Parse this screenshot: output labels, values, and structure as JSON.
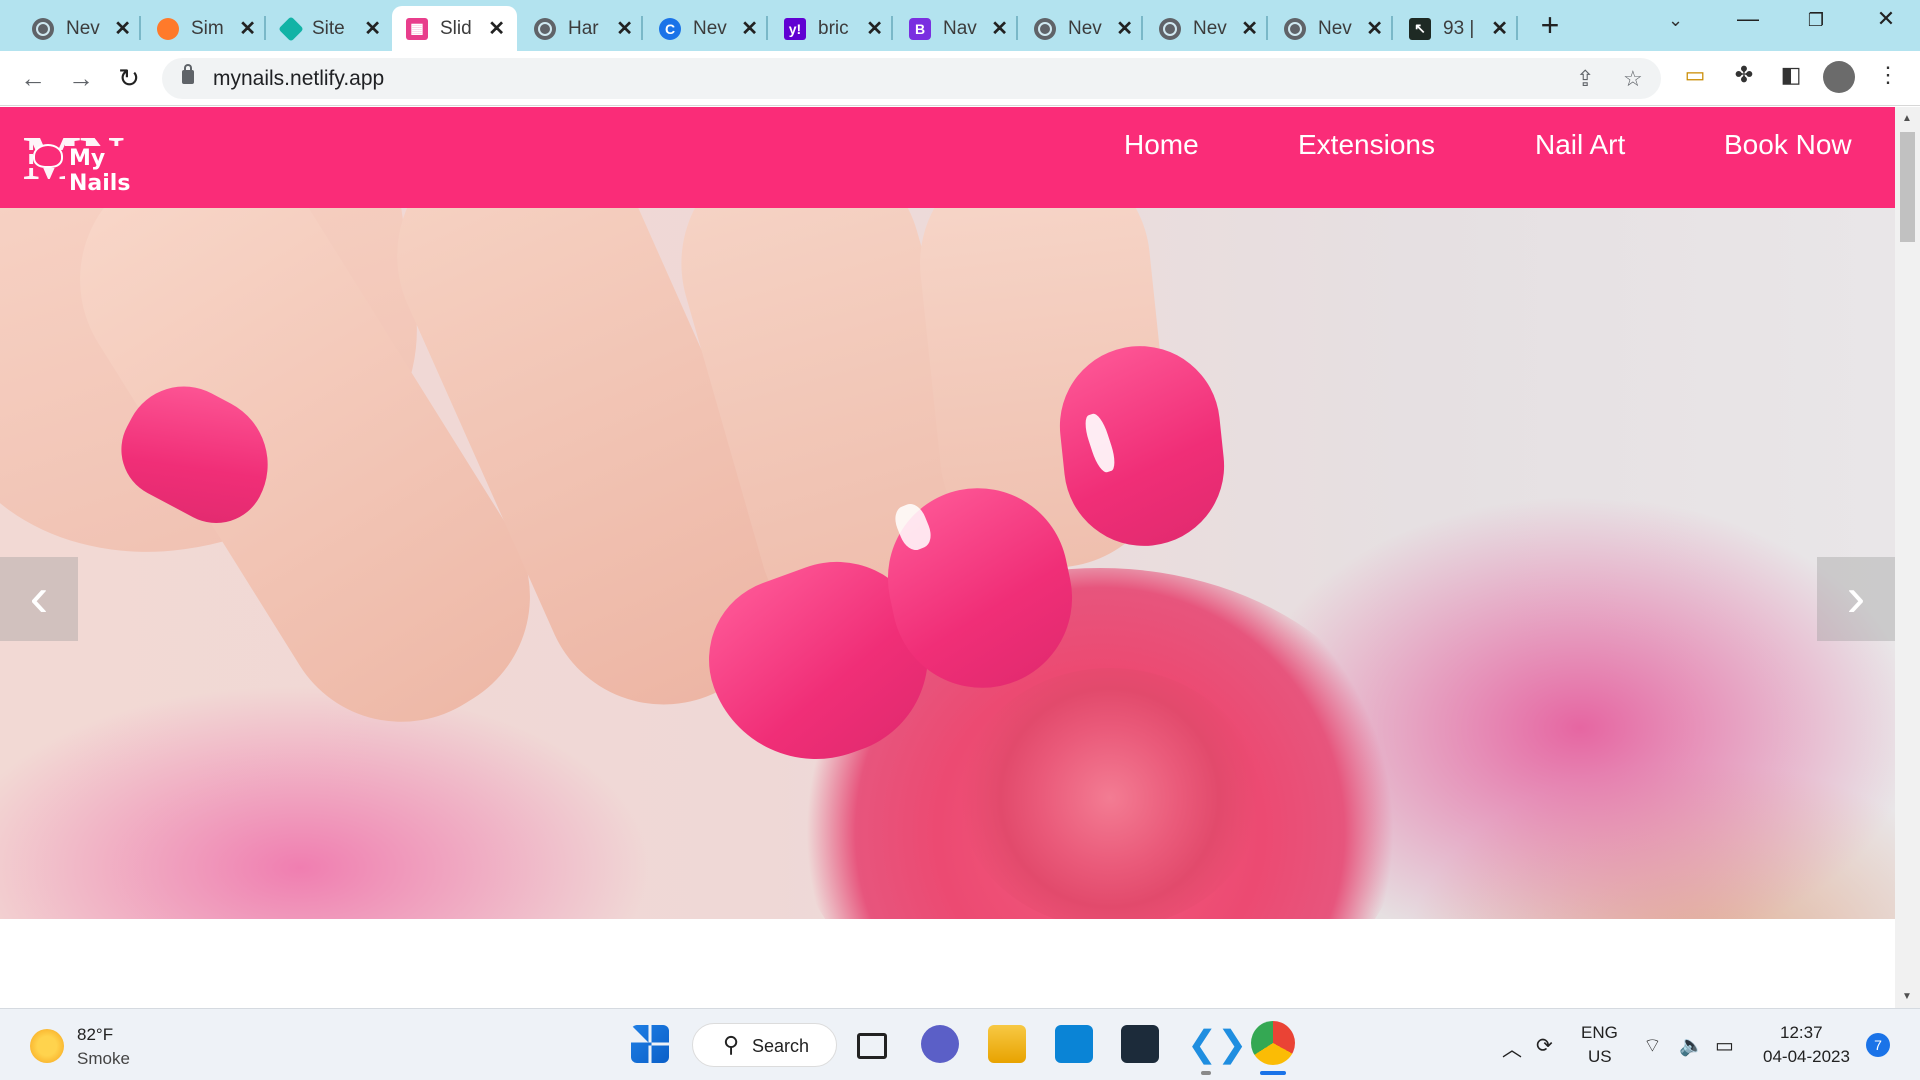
{
  "browser": {
    "tabs": [
      {
        "title": "Nev",
        "favicon": "globe-icon"
      },
      {
        "title": "Sim",
        "favicon": "orange-avatar-icon"
      },
      {
        "title": "Site",
        "favicon": "teal-diamond-icon"
      },
      {
        "title": "Slid",
        "favicon": "pink-grid-icon",
        "active": true
      },
      {
        "title": "Har",
        "favicon": "globe-icon"
      },
      {
        "title": "Nev",
        "favicon": "blue-c-icon"
      },
      {
        "title": "bric",
        "favicon": "yahoo-icon"
      },
      {
        "title": "Nav",
        "favicon": "bootstrap-icon"
      },
      {
        "title": "Nev",
        "favicon": "globe-icon"
      },
      {
        "title": "Nev",
        "favicon": "globe-icon"
      },
      {
        "title": "Nev",
        "favicon": "globe-icon"
      },
      {
        "title": "93 |",
        "favicon": "cursor-icon"
      }
    ],
    "new_tab_label": "+",
    "address": "mynails.netlify.app"
  },
  "site": {
    "logo_letters": "MN",
    "brand": "My Nails",
    "menu": [
      "Home",
      "Extensions",
      "Nail Art",
      "Book Now"
    ],
    "prev_arrow": "‹",
    "next_arrow": "›",
    "colors": {
      "header": "#fa2c78",
      "nail": "#f5397f"
    }
  },
  "taskbar": {
    "weather_temp": "82°F",
    "weather_cond": "Smoke",
    "search_label": "Search",
    "lang_top": "ENG",
    "lang_bottom": "US",
    "time": "12:37",
    "date": "04-04-2023",
    "notifications": "7"
  }
}
